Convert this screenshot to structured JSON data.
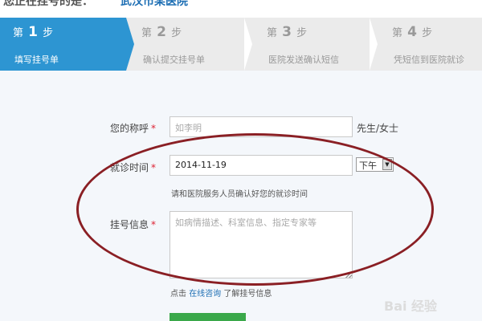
{
  "header": {
    "title_left": "您正在挂号的是：",
    "title_right": "武汉市某医院"
  },
  "steps": [
    {
      "prefix": "第",
      "num": "1",
      "suffix": "步",
      "desc": "填写挂号单"
    },
    {
      "prefix": "第",
      "num": "2",
      "suffix": "步",
      "desc": "确认提交挂号单"
    },
    {
      "prefix": "第",
      "num": "3",
      "suffix": "步",
      "desc": "医院发送确认短信"
    },
    {
      "prefix": "第",
      "num": "4",
      "suffix": "步",
      "desc": "凭短信到医院就诊"
    }
  ],
  "form": {
    "name_label": "您的称呼",
    "name_placeholder": "如李明",
    "name_suffix": "先生/女士",
    "time_label": "就诊时间",
    "date_value": "2014-11-19",
    "period_value": "下午",
    "time_hint": "请和医院服务人员确认好您的就诊时间",
    "info_label": "挂号信息",
    "info_placeholder": "如病情描述、科室信息、指定专家等",
    "help_prefix": "点击",
    "help_link": "在线咨询",
    "help_suffix": "了解挂号信息",
    "required_mark": "*"
  },
  "watermark": "Bai 经验",
  "colors": {
    "active_step": "#2d95d2",
    "annotation_ellipse": "#8a1f24",
    "link": "#1e6fb4",
    "submit": "#3aa84a"
  }
}
